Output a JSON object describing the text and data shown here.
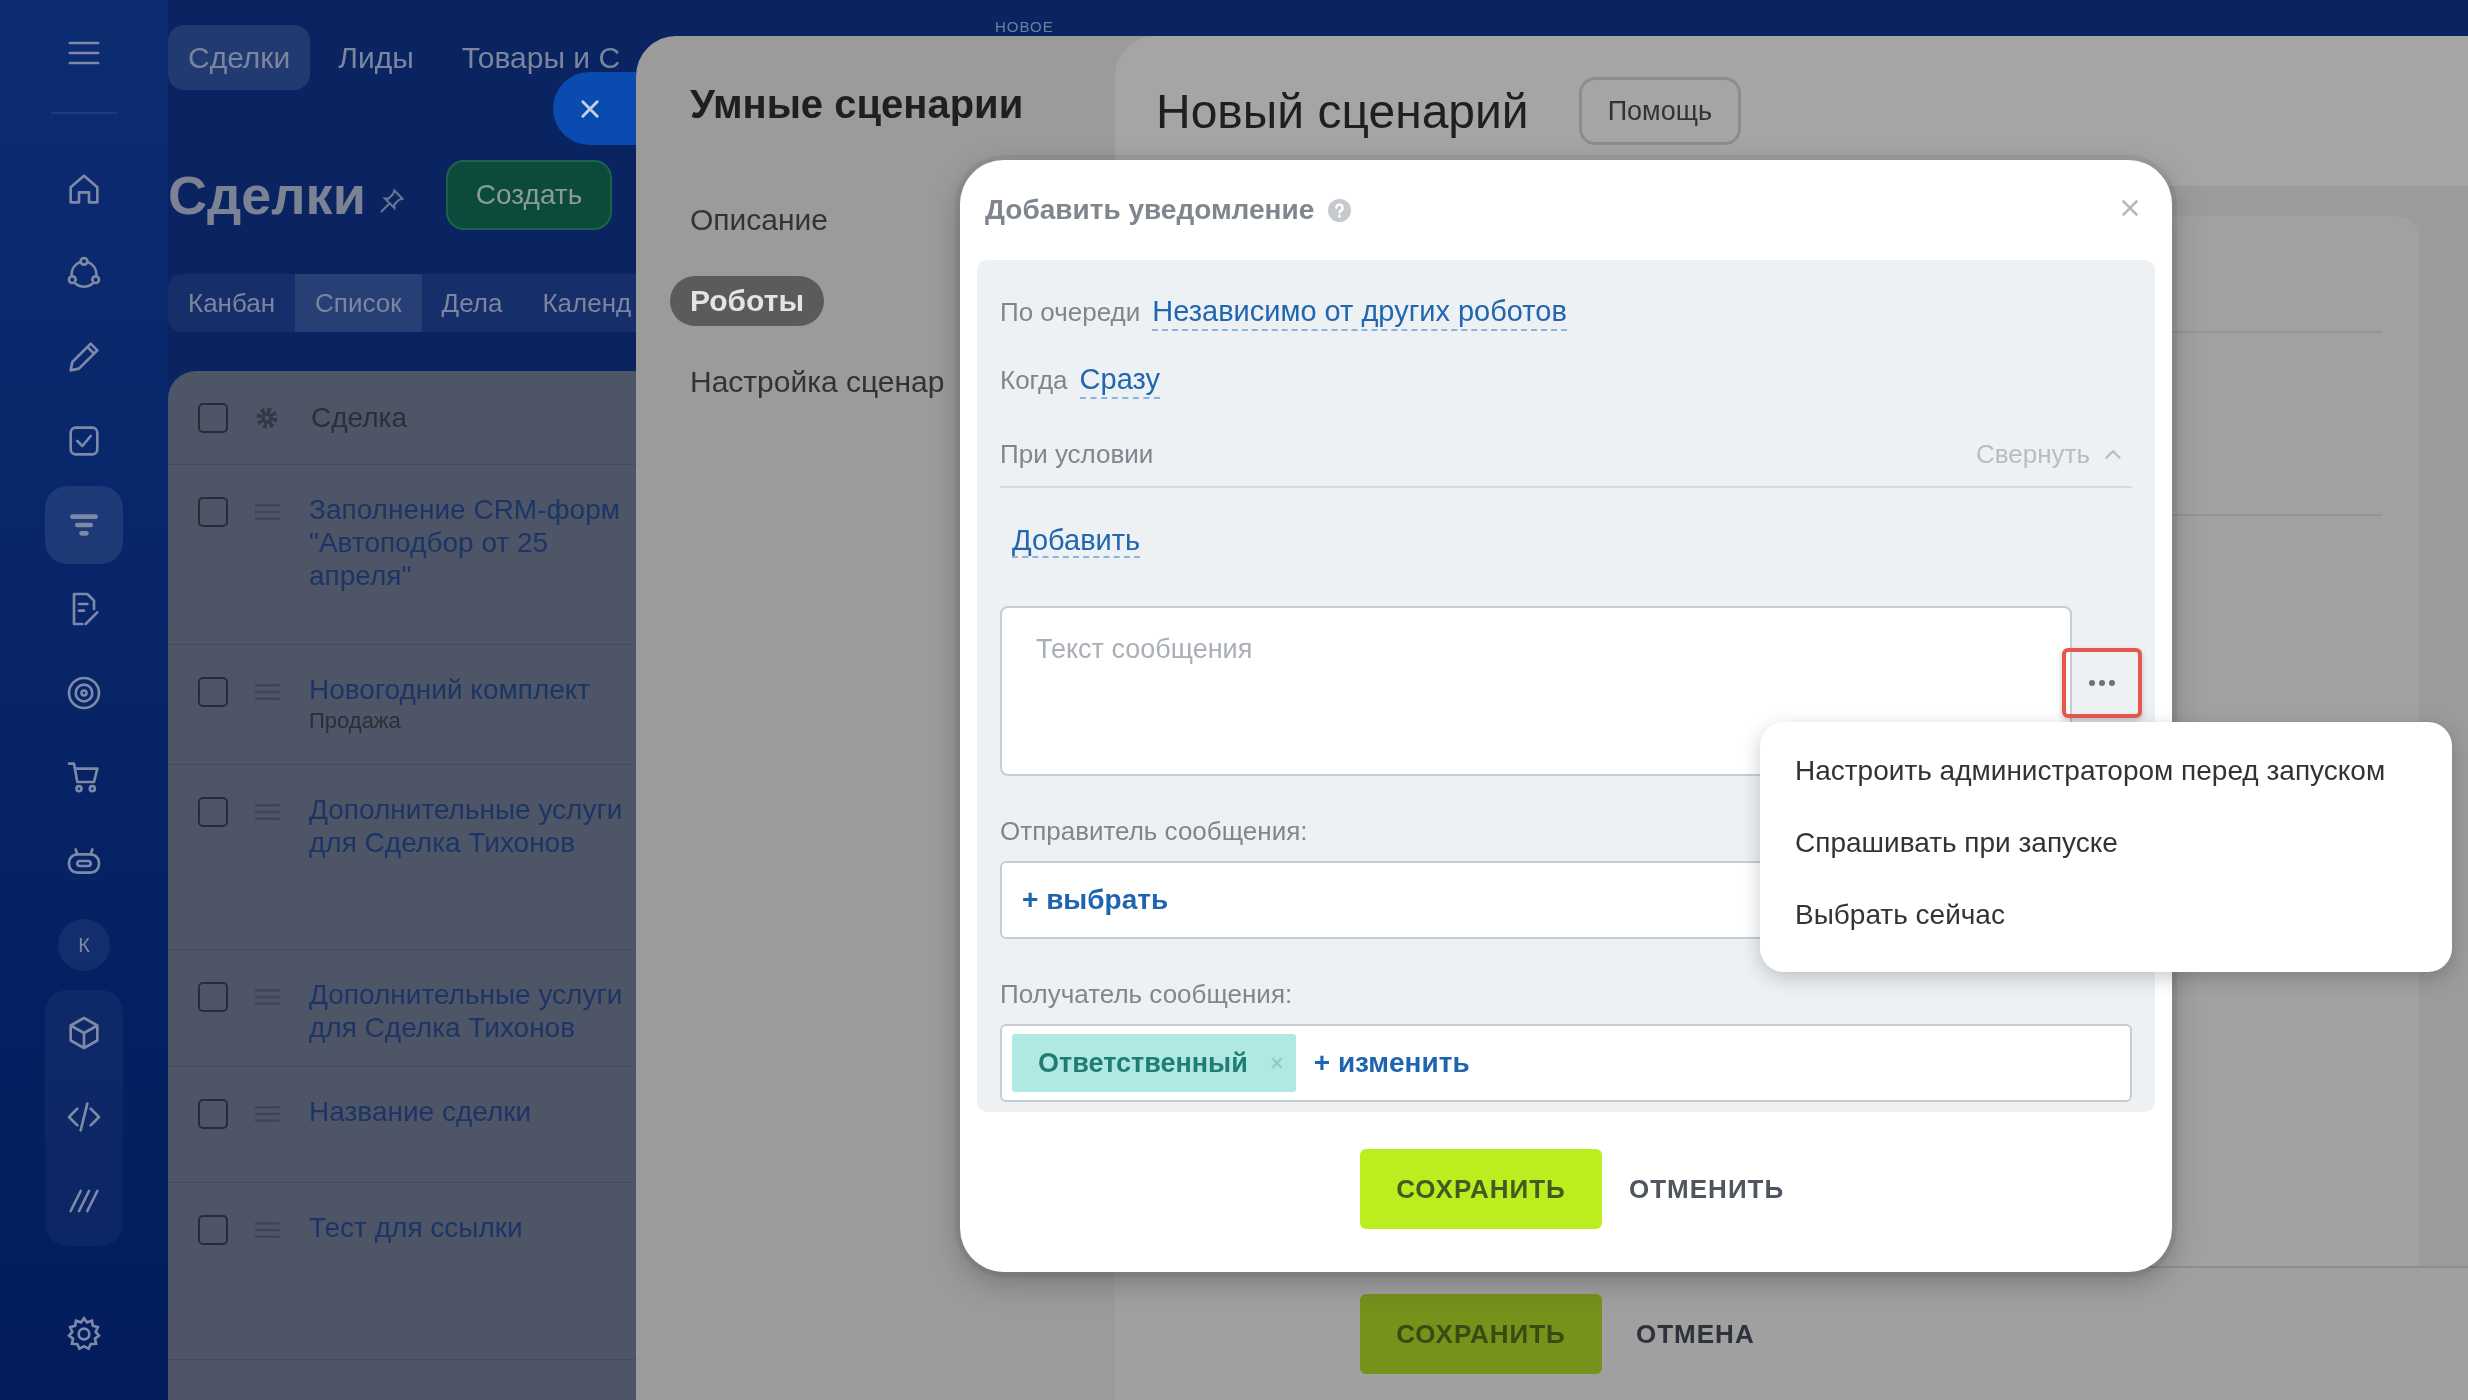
{
  "crm": {
    "sidebar": {
      "items": [
        {
          "kind": "icon",
          "selected": false
        },
        {
          "kind": "icon",
          "selected": false
        },
        {
          "kind": "icon",
          "selected": false
        },
        {
          "kind": "icon",
          "selected": false
        },
        {
          "kind": "icon",
          "selected": true
        },
        {
          "kind": "icon",
          "selected": false
        },
        {
          "kind": "icon",
          "selected": false
        },
        {
          "kind": "icon",
          "selected": false
        },
        {
          "kind": "icon",
          "selected": false
        },
        {
          "kind": "avatar",
          "selected": false,
          "initial": "К"
        },
        {
          "kind": "icon",
          "selected": false
        },
        {
          "kind": "icon",
          "selected": false
        },
        {
          "kind": "icon",
          "selected": false
        }
      ]
    },
    "top_tabs": [
      {
        "label": "Сделки",
        "selected": true
      },
      {
        "label": "Лиды",
        "selected": false
      },
      {
        "label": "Товары и С",
        "selected": false
      }
    ],
    "title": "Сделки",
    "create_button": "Создать",
    "view_tabs": [
      {
        "label": "Канбан",
        "selected": false
      },
      {
        "label": "Список",
        "selected": true
      },
      {
        "label": "Дела",
        "selected": false
      },
      {
        "label": "Календ",
        "selected": false
      }
    ],
    "list": {
      "header": "Сделка",
      "all_checked": false,
      "rows": [
        {
          "checked": false,
          "title": "Заполнение CRM-форм\n\"Автоподбор от 25\nапреля\""
        },
        {
          "checked": false,
          "title": "Новогодний комплект",
          "subtitle": "Продажа"
        },
        {
          "checked": false,
          "title": "Дополнительные услуги\nдля Сделка Тихонов"
        },
        {
          "checked": false,
          "title": "Дополнительные услуги\nдля Сделка Тихонов"
        },
        {
          "checked": false,
          "title": "Название сделки"
        },
        {
          "checked": false,
          "title": "Тест для ссылки"
        }
      ]
    }
  },
  "panel": {
    "badge": "НОВОЕ",
    "nav_title": "Умные сценарии",
    "nav_items": [
      {
        "label": "Описание",
        "selected": false
      },
      {
        "label": "Роботы",
        "selected": true
      },
      {
        "label": "Настройка сценар",
        "selected": false
      }
    ],
    "title": "Новый сценарий",
    "help_button": "Помощь",
    "footer": {
      "save": "СОХРАНИТЬ",
      "cancel": "ОТМЕНА"
    }
  },
  "modal": {
    "title": "Добавить уведомление",
    "queue": {
      "label": "По очереди",
      "value": "Независимо от других роботов"
    },
    "when": {
      "label": "Когда",
      "value": "Сразу"
    },
    "condition": {
      "label": "При условии",
      "toggle": "Свернуть",
      "expanded": true,
      "add_link": "Добавить"
    },
    "message": {
      "placeholder": "Текст сообщения",
      "more_highlighted": true
    },
    "sender": {
      "label": "Отправитель сообщения:",
      "action": "+ выбрать"
    },
    "recipient": {
      "label": "Получатель сообщения:",
      "tags": [
        {
          "label": "Ответственный"
        }
      ],
      "action": "+ изменить"
    },
    "buttons": {
      "save": "СОХРАНИТЬ",
      "cancel": "ОТМЕНИТЬ"
    }
  },
  "menu": {
    "items": [
      {
        "label": "Настроить администратором перед запуском"
      },
      {
        "label": "Спрашивать при запуске"
      },
      {
        "label": "Выбрать сейчас"
      }
    ]
  }
}
